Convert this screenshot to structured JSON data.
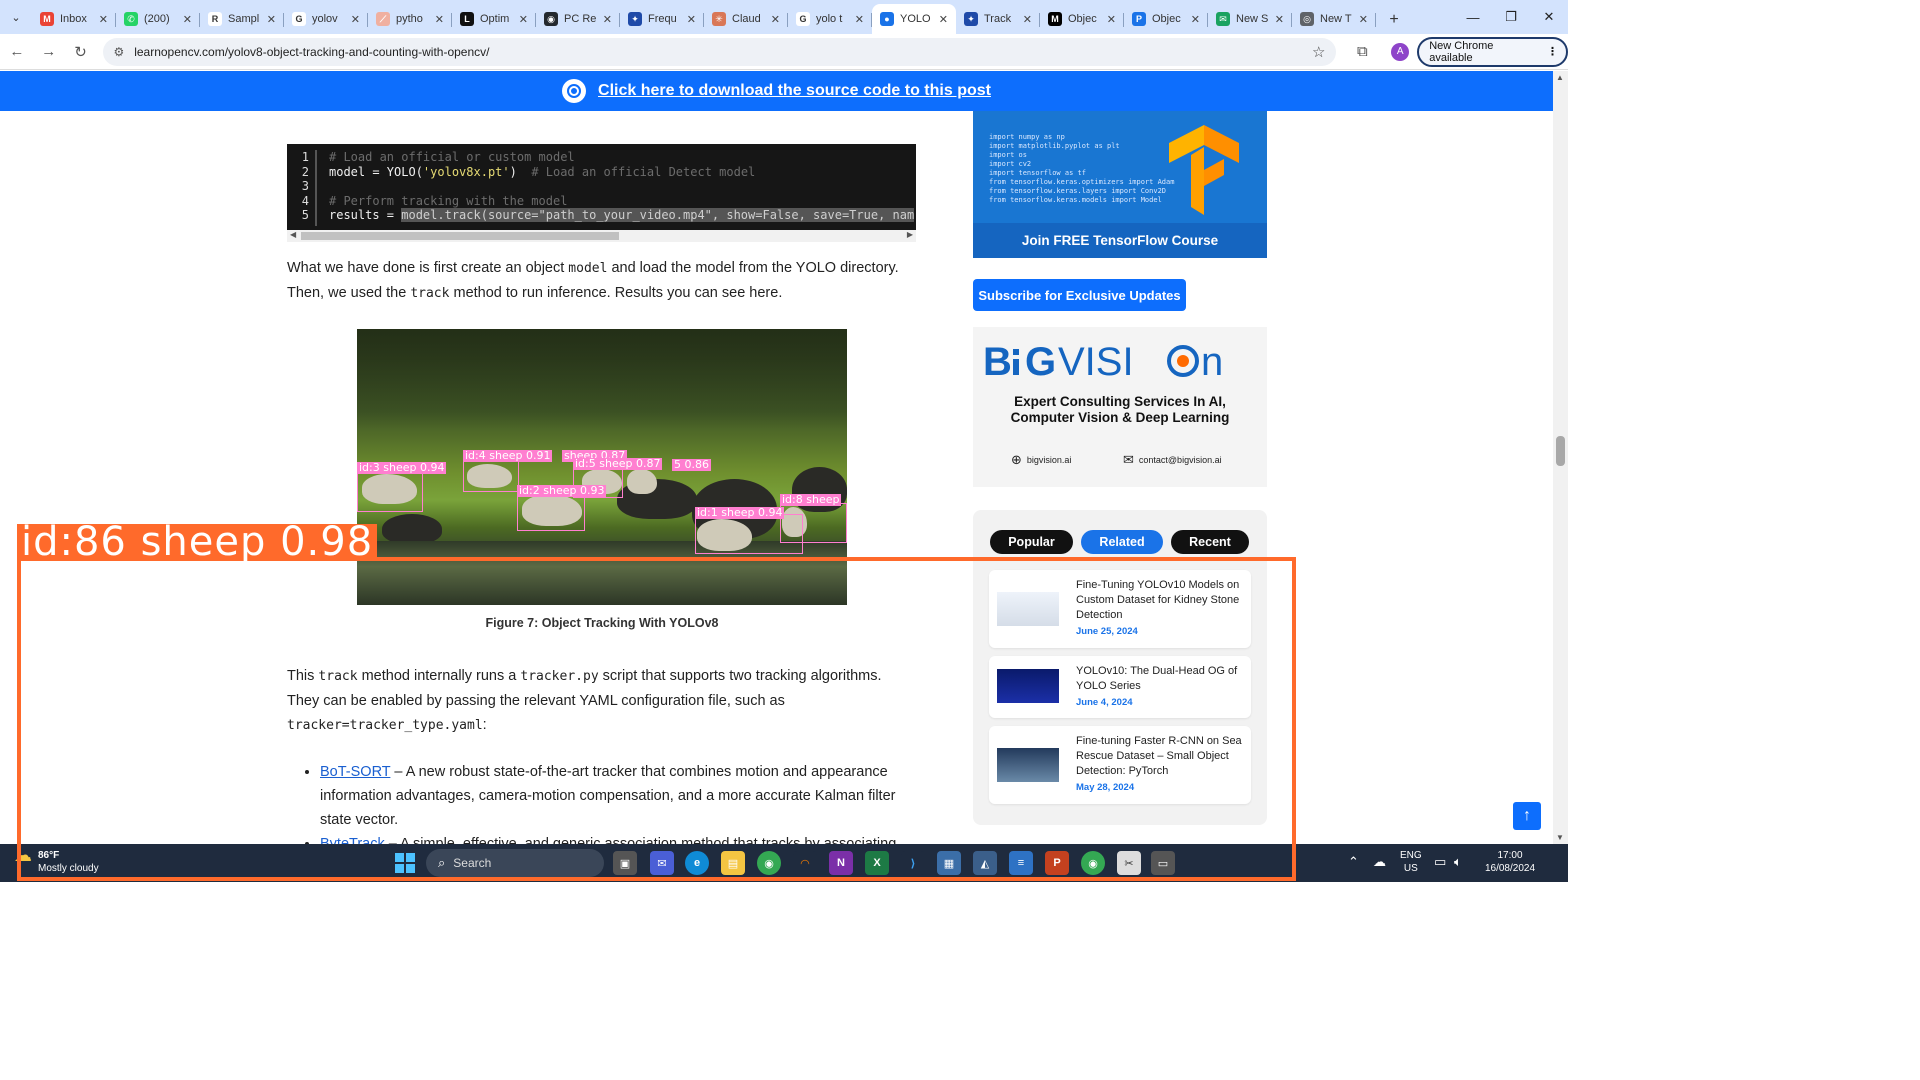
{
  "browser": {
    "tabs": [
      {
        "title": "Inbox",
        "fav_color": "#ea4335",
        "fav_glyph": "M"
      },
      {
        "title": "(200)",
        "fav_color": "#25d366",
        "fav_glyph": "✆"
      },
      {
        "title": "Sampl",
        "fav_color": "#ffffff",
        "fav_glyph": "R"
      },
      {
        "title": "yolov",
        "fav_color": "#ffffff",
        "fav_glyph": "G"
      },
      {
        "title": "pytho",
        "fav_color": "#f0b0a0",
        "fav_glyph": "⟋"
      },
      {
        "title": "Optim",
        "fav_color": "#111111",
        "fav_glyph": "L"
      },
      {
        "title": "PC Re",
        "fav_color": "#24292e",
        "fav_glyph": "◉"
      },
      {
        "title": "Frequ",
        "fav_color": "#1f4aa8",
        "fav_glyph": "✦"
      },
      {
        "title": "Claud",
        "fav_color": "#d97757",
        "fav_glyph": "✳"
      },
      {
        "title": "yolo t",
        "fav_color": "#ffffff",
        "fav_glyph": "G"
      },
      {
        "title": "YOLO",
        "fav_color": "#1a73e8",
        "fav_glyph": "●"
      },
      {
        "title": "Track",
        "fav_color": "#1f4aa8",
        "fav_glyph": "✦"
      },
      {
        "title": "Objec",
        "fav_color": "#000000",
        "fav_glyph": "M"
      },
      {
        "title": "Objec",
        "fav_color": "#1a73e8",
        "fav_glyph": "P"
      },
      {
        "title": "New S",
        "fav_color": "#1aa260",
        "fav_glyph": "✉"
      },
      {
        "title": "New T",
        "fav_color": "#5f6368",
        "fav_glyph": "◎"
      }
    ],
    "active_tab_index": 10,
    "url": "learnopencv.com/yolov8-object-tracking-and-counting-with-opencv/",
    "new_chrome_label": "New Chrome available",
    "profile_initial": "A"
  },
  "banner": {
    "text": "Click here to download the source code to this post"
  },
  "code": {
    "line_numbers": [
      "1",
      "2",
      "3",
      "4",
      "5"
    ]
  },
  "article": {
    "para1_a": "What we have done is first create an object ",
    "para1_code": "model",
    "para1_b": " and load the model from the YOLO directory.",
    "para1_c": "Then, we used the ",
    "para1_code2": "track",
    "para1_d": " method to run inference. Results you can see here.",
    "figure_caption": "Figure 7: Object Tracking With YOLOv8",
    "para2_a": "This ",
    "para2_code1": "track",
    "para2_b": " method internally runs a ",
    "para2_code2": "tracker.py",
    "para2_c": " script that supports two tracking algorithms.",
    "para2_d": "They can be enabled by passing the relevant YAML configuration file, such as",
    "para2_code3": "tracker=tracker_type.yaml",
    "para2_e": ":",
    "bullet1_link": "BoT-SORT",
    "bullet1_text": " – A new robust state-of-the-art tracker that combines motion and appearance information advantages, camera-motion compensation, and a more accurate Kalman filter state vector.",
    "bullet2_link": "ByteTrack",
    "bullet2_text": " – A simple, effective, and generic association method that tracks by associating"
  },
  "figure": {
    "detections": [
      "id:3 sheep 0.94",
      "id:4 sheep 0.91",
      "sheep 0.87",
      "id:5 sheep 0.87",
      "5 0.86",
      "id:2 sheep 0.93",
      "id:8 sheep",
      "id:1 sheep 0.94"
    ]
  },
  "sidebar": {
    "tf_button": "Join FREE TensorFlow Course",
    "subscribe": "Subscribe for Exclusive Updates",
    "bigvision_tagline_1": "Expert Consulting Services In AI,",
    "bigvision_tagline_2": "Computer Vision & Deep Learning",
    "bigvision_site": "bigvision.ai",
    "bigvision_email": "contact@bigvision.ai",
    "tabs": {
      "popular": "Popular",
      "related": "Related",
      "recent": "Recent"
    },
    "posts": [
      {
        "title": "Fine-Tuning YOLOv10 Models on Custom Dataset for Kidney Stone Detection",
        "date": "June 25, 2024"
      },
      {
        "title": "YOLOv10: The Dual-Head OG of YOLO Series",
        "date": "June 4, 2024"
      },
      {
        "title": "Fine-tuning Faster R-CNN on Sea Rescue Dataset – Small Object Detection: PyTorch",
        "date": "May 28, 2024"
      }
    ]
  },
  "overlay": {
    "label": "id:86 sheep 0.98",
    "color": "#ff6a2b"
  },
  "taskbar": {
    "temp": "86°F",
    "weather": "Mostly cloudy",
    "search_placeholder": "Search",
    "lang_1": "ENG",
    "lang_2": "US",
    "time": "17:00",
    "date": "16/08/2024"
  }
}
